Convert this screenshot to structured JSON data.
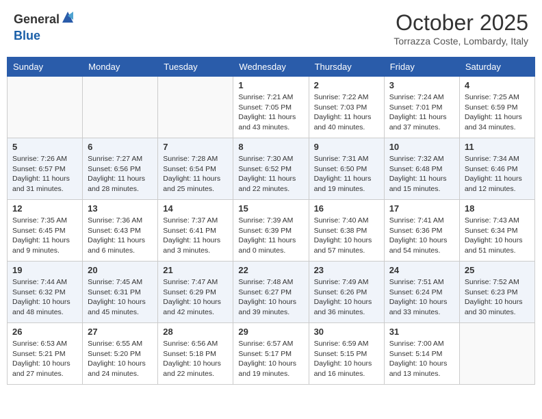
{
  "header": {
    "logo_general": "General",
    "logo_blue": "Blue",
    "month": "October 2025",
    "location": "Torrazza Coste, Lombardy, Italy"
  },
  "weekdays": [
    "Sunday",
    "Monday",
    "Tuesday",
    "Wednesday",
    "Thursday",
    "Friday",
    "Saturday"
  ],
  "weeks": [
    [
      {
        "day": "",
        "info": ""
      },
      {
        "day": "",
        "info": ""
      },
      {
        "day": "",
        "info": ""
      },
      {
        "day": "1",
        "info": "Sunrise: 7:21 AM\nSunset: 7:05 PM\nDaylight: 11 hours\nand 43 minutes."
      },
      {
        "day": "2",
        "info": "Sunrise: 7:22 AM\nSunset: 7:03 PM\nDaylight: 11 hours\nand 40 minutes."
      },
      {
        "day": "3",
        "info": "Sunrise: 7:24 AM\nSunset: 7:01 PM\nDaylight: 11 hours\nand 37 minutes."
      },
      {
        "day": "4",
        "info": "Sunrise: 7:25 AM\nSunset: 6:59 PM\nDaylight: 11 hours\nand 34 minutes."
      }
    ],
    [
      {
        "day": "5",
        "info": "Sunrise: 7:26 AM\nSunset: 6:57 PM\nDaylight: 11 hours\nand 31 minutes."
      },
      {
        "day": "6",
        "info": "Sunrise: 7:27 AM\nSunset: 6:56 PM\nDaylight: 11 hours\nand 28 minutes."
      },
      {
        "day": "7",
        "info": "Sunrise: 7:28 AM\nSunset: 6:54 PM\nDaylight: 11 hours\nand 25 minutes."
      },
      {
        "day": "8",
        "info": "Sunrise: 7:30 AM\nSunset: 6:52 PM\nDaylight: 11 hours\nand 22 minutes."
      },
      {
        "day": "9",
        "info": "Sunrise: 7:31 AM\nSunset: 6:50 PM\nDaylight: 11 hours\nand 19 minutes."
      },
      {
        "day": "10",
        "info": "Sunrise: 7:32 AM\nSunset: 6:48 PM\nDaylight: 11 hours\nand 15 minutes."
      },
      {
        "day": "11",
        "info": "Sunrise: 7:34 AM\nSunset: 6:46 PM\nDaylight: 11 hours\nand 12 minutes."
      }
    ],
    [
      {
        "day": "12",
        "info": "Sunrise: 7:35 AM\nSunset: 6:45 PM\nDaylight: 11 hours\nand 9 minutes."
      },
      {
        "day": "13",
        "info": "Sunrise: 7:36 AM\nSunset: 6:43 PM\nDaylight: 11 hours\nand 6 minutes."
      },
      {
        "day": "14",
        "info": "Sunrise: 7:37 AM\nSunset: 6:41 PM\nDaylight: 11 hours\nand 3 minutes."
      },
      {
        "day": "15",
        "info": "Sunrise: 7:39 AM\nSunset: 6:39 PM\nDaylight: 11 hours\nand 0 minutes."
      },
      {
        "day": "16",
        "info": "Sunrise: 7:40 AM\nSunset: 6:38 PM\nDaylight: 10 hours\nand 57 minutes."
      },
      {
        "day": "17",
        "info": "Sunrise: 7:41 AM\nSunset: 6:36 PM\nDaylight: 10 hours\nand 54 minutes."
      },
      {
        "day": "18",
        "info": "Sunrise: 7:43 AM\nSunset: 6:34 PM\nDaylight: 10 hours\nand 51 minutes."
      }
    ],
    [
      {
        "day": "19",
        "info": "Sunrise: 7:44 AM\nSunset: 6:32 PM\nDaylight: 10 hours\nand 48 minutes."
      },
      {
        "day": "20",
        "info": "Sunrise: 7:45 AM\nSunset: 6:31 PM\nDaylight: 10 hours\nand 45 minutes."
      },
      {
        "day": "21",
        "info": "Sunrise: 7:47 AM\nSunset: 6:29 PM\nDaylight: 10 hours\nand 42 minutes."
      },
      {
        "day": "22",
        "info": "Sunrise: 7:48 AM\nSunset: 6:27 PM\nDaylight: 10 hours\nand 39 minutes."
      },
      {
        "day": "23",
        "info": "Sunrise: 7:49 AM\nSunset: 6:26 PM\nDaylight: 10 hours\nand 36 minutes."
      },
      {
        "day": "24",
        "info": "Sunrise: 7:51 AM\nSunset: 6:24 PM\nDaylight: 10 hours\nand 33 minutes."
      },
      {
        "day": "25",
        "info": "Sunrise: 7:52 AM\nSunset: 6:23 PM\nDaylight: 10 hours\nand 30 minutes."
      }
    ],
    [
      {
        "day": "26",
        "info": "Sunrise: 6:53 AM\nSunset: 5:21 PM\nDaylight: 10 hours\nand 27 minutes."
      },
      {
        "day": "27",
        "info": "Sunrise: 6:55 AM\nSunset: 5:20 PM\nDaylight: 10 hours\nand 24 minutes."
      },
      {
        "day": "28",
        "info": "Sunrise: 6:56 AM\nSunset: 5:18 PM\nDaylight: 10 hours\nand 22 minutes."
      },
      {
        "day": "29",
        "info": "Sunrise: 6:57 AM\nSunset: 5:17 PM\nDaylight: 10 hours\nand 19 minutes."
      },
      {
        "day": "30",
        "info": "Sunrise: 6:59 AM\nSunset: 5:15 PM\nDaylight: 10 hours\nand 16 minutes."
      },
      {
        "day": "31",
        "info": "Sunrise: 7:00 AM\nSunset: 5:14 PM\nDaylight: 10 hours\nand 13 minutes."
      },
      {
        "day": "",
        "info": ""
      }
    ]
  ]
}
